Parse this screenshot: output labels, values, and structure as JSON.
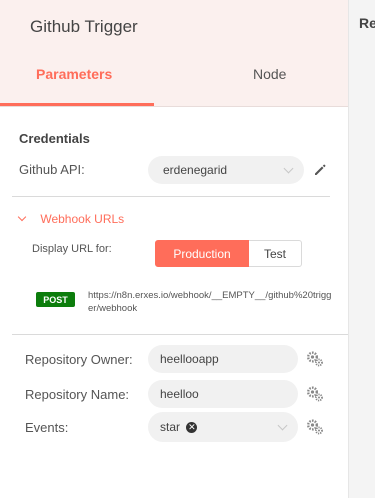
{
  "header": {
    "title": "Github Trigger",
    "tabs": [
      {
        "label": "Parameters",
        "active": true
      },
      {
        "label": "Node",
        "active": false
      }
    ]
  },
  "right_pane": {
    "title": "Re"
  },
  "credentials": {
    "section_title": "Credentials",
    "api_label": "Github API:",
    "api_value": "erdenegarid"
  },
  "webhook": {
    "toggle_label": "Webhook URLs",
    "display_url_label": "Display URL for:",
    "options": [
      "Production",
      "Test"
    ],
    "selected": "Production",
    "method": "POST",
    "url": "https://n8n.erxes.io/webhook/__EMPTY__/github%20trigger/webhook"
  },
  "fields": {
    "repo_owner_label": "Repository Owner:",
    "repo_owner_value": "heellooapp",
    "repo_name_label": "Repository Name:",
    "repo_name_value": "heelloo",
    "events_label": "Events:",
    "events_tag": "star"
  },
  "colors": {
    "accent": "#ff6d5a",
    "post_badge": "#0c7d0c",
    "header_bg": "#fbf0ee"
  }
}
